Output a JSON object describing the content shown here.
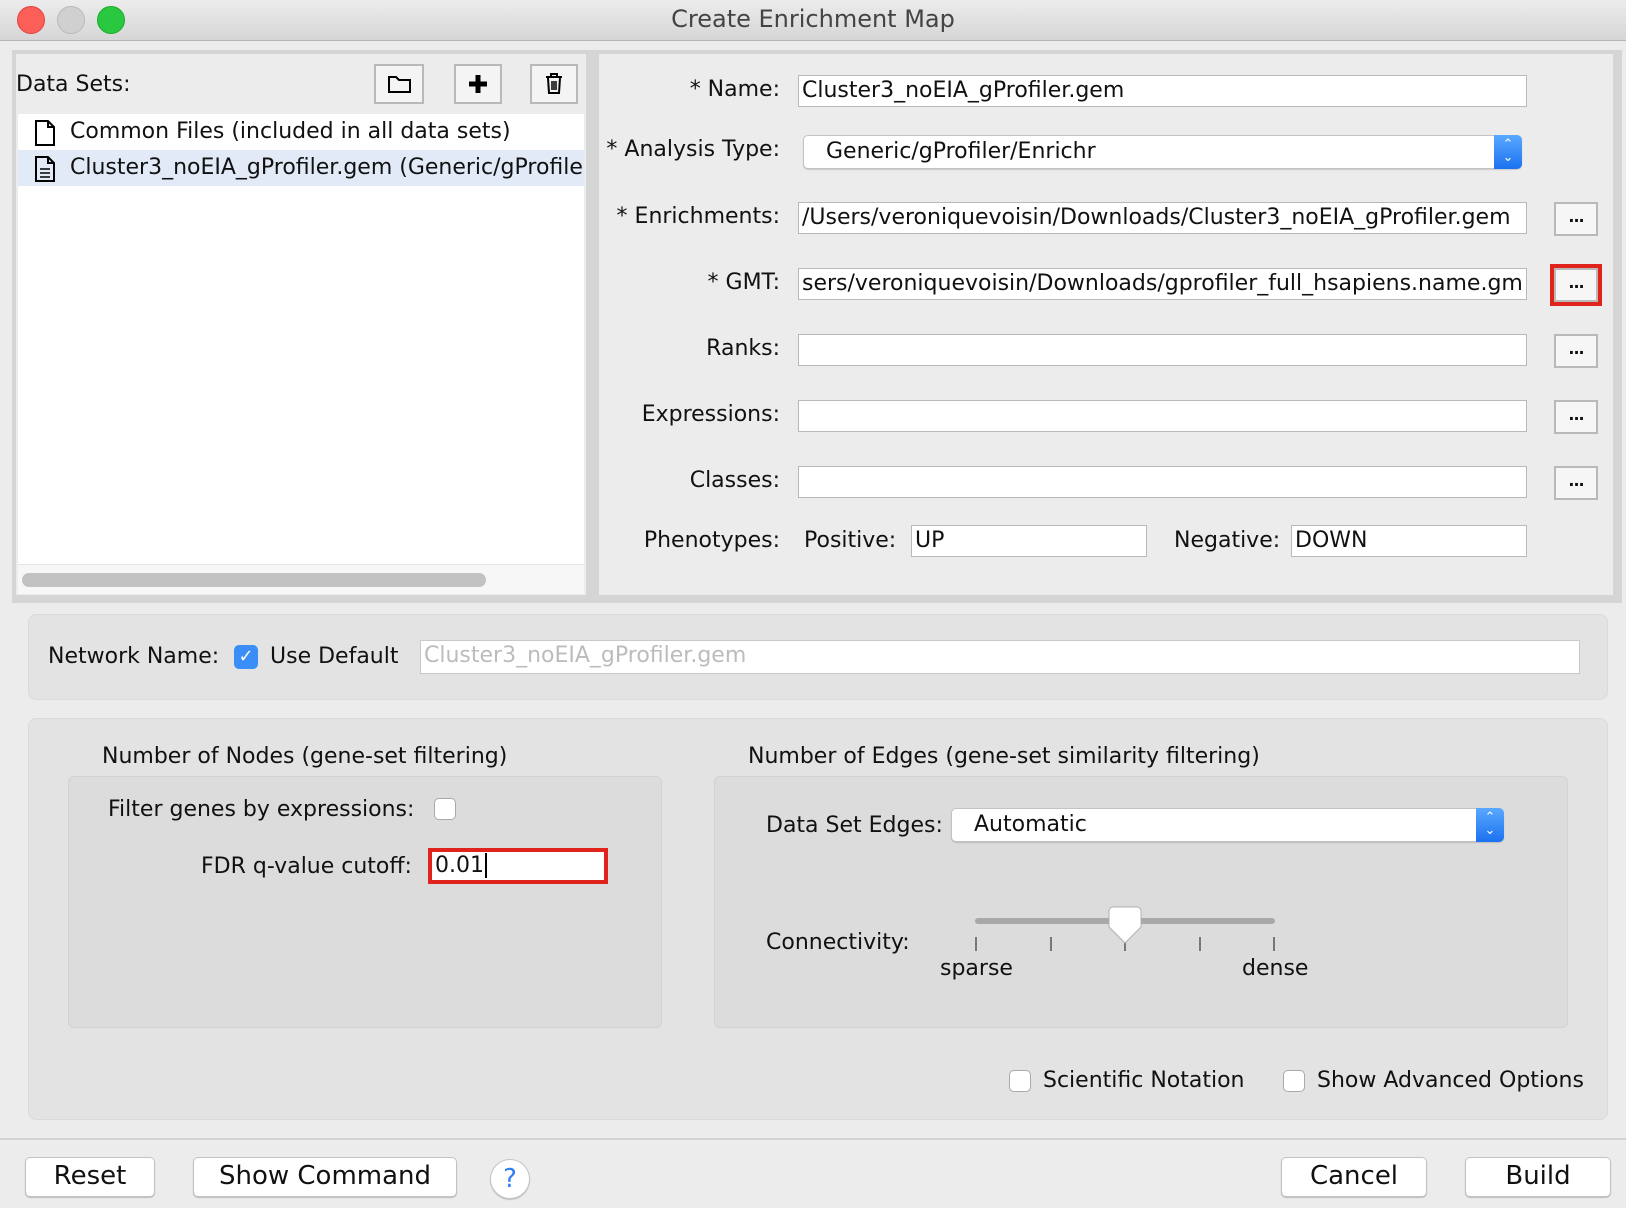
{
  "window": {
    "title": "Create Enrichment Map"
  },
  "data_sets": {
    "label": "Data Sets:",
    "toolbar": {
      "open_icon": "folder-icon",
      "add_icon": "plus-icon",
      "delete_icon": "trash-icon"
    },
    "items": [
      {
        "label": "Common Files (included in all data sets)",
        "icon": "file-icon",
        "selected": false
      },
      {
        "label": "Cluster3_noEIA_gProfiler.gem  (Generic/gProfile",
        "icon": "text-file-icon",
        "selected": true
      }
    ]
  },
  "form": {
    "name": {
      "label": "* Name:",
      "value": "Cluster3_noEIA_gProfiler.gem"
    },
    "analysis_type": {
      "label": "* Analysis Type:",
      "value": "Generic/gProfiler/Enrichr"
    },
    "enrichments": {
      "label": "* Enrichments:",
      "value": "/Users/veroniquevoisin/Downloads/Cluster3_noEIA_gProfiler.gem",
      "browse": "..."
    },
    "gmt": {
      "label": "* GMT:",
      "value": "sers/veroniquevoisin/Downloads/gprofiler_full_hsapiens.name.gm",
      "browse": "..."
    },
    "ranks": {
      "label": "Ranks:",
      "value": "",
      "browse": "..."
    },
    "expressions": {
      "label": "Expressions:",
      "value": "",
      "browse": "..."
    },
    "classes": {
      "label": "Classes:",
      "value": "",
      "browse": "..."
    },
    "phenotypes": {
      "label": "Phenotypes:",
      "positive_label": "Positive:",
      "positive": "UP",
      "negative_label": "Negative:",
      "negative": "DOWN"
    }
  },
  "network": {
    "label": "Network Name:",
    "use_default_label": "Use Default",
    "use_default": true,
    "value": "Cluster3_noEIA_gProfiler.gem"
  },
  "nodes": {
    "title": "Number of Nodes (gene-set filtering)",
    "filter_label": "Filter genes by expressions:",
    "filter_checked": false,
    "fdr_label": "FDR q-value cutoff:",
    "fdr_value": "0.01"
  },
  "edges": {
    "title": "Number of Edges (gene-set similarity filtering)",
    "data_set_edges_label": "Data Set Edges:",
    "data_set_edges_value": "Automatic",
    "connectivity_label": "Connectivity:",
    "connectivity_position": 0.5,
    "sparse_label": "sparse",
    "dense_label": "dense"
  },
  "options": {
    "scientific_notation": "Scientific Notation",
    "scientific_checked": false,
    "advanced": "Show Advanced Options",
    "advanced_checked": false
  },
  "footer": {
    "reset": "Reset",
    "show_command": "Show Command",
    "help": "?",
    "cancel": "Cancel",
    "build": "Build"
  },
  "colors": {
    "highlight": "#e0231c",
    "accent": "#1b72f0",
    "selection": "#e2eaf8"
  }
}
